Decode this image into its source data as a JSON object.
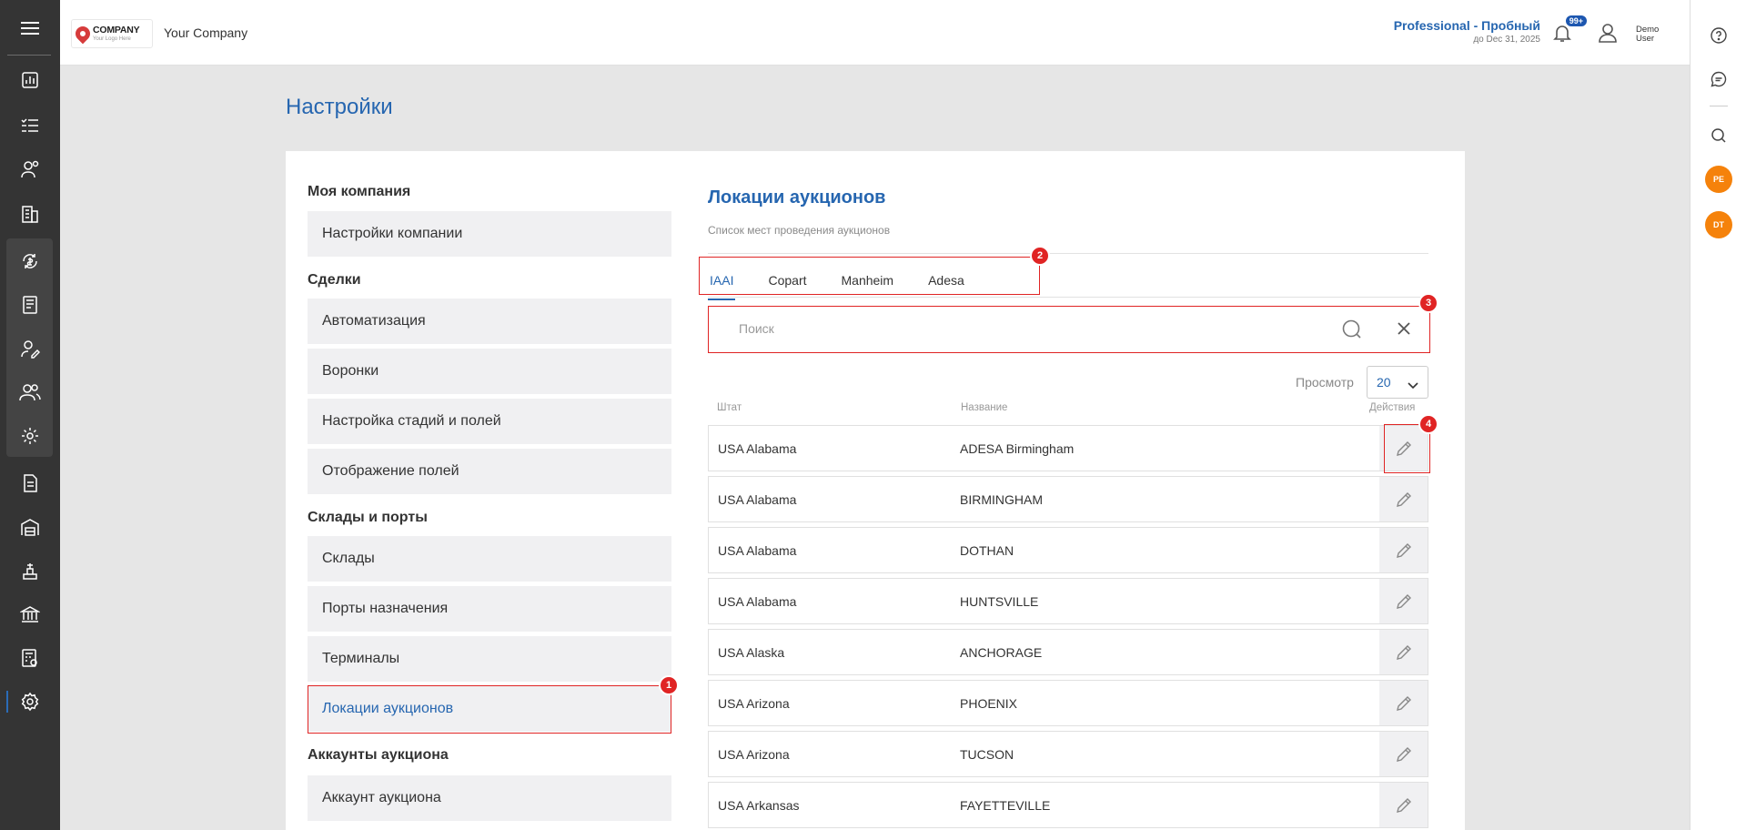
{
  "topbar": {
    "logo_name": "COMPANY",
    "logo_sub": "Your Logo Here",
    "company": "Your Company",
    "plan_name": "Professional - Пробный",
    "plan_date": "до Dec 31, 2025",
    "notif_count": "99+",
    "user_line1": "Demo",
    "user_line2": "User"
  },
  "rail": {
    "icons": [
      "menu-icon",
      "dashboard-icon",
      "tasks-icon",
      "contacts-icon",
      "companies-icon",
      "finance-icon",
      "invoices-icon",
      "user-edit-icon",
      "users-icon",
      "settings-gear-icon",
      "documents-icon",
      "warehouse-icon",
      "auction-icon",
      "bank-icon",
      "calculator-icon",
      "settings-icon"
    ]
  },
  "right_rail": {
    "avatar1": "PE",
    "avatar2": "DT"
  },
  "page": {
    "title": "Настройки"
  },
  "sidebar": {
    "sections": [
      {
        "title": "Моя компания",
        "items": [
          "Настройки компании"
        ]
      },
      {
        "title": "Сделки",
        "items": [
          "Автоматизация",
          "Воронки",
          "Настройка стадий и полей",
          "Отображение полей"
        ]
      },
      {
        "title": "Склады и порты",
        "items": [
          "Склады",
          "Порты назначения",
          "Терминалы",
          "Локации аукционов"
        ]
      },
      {
        "title": "Аккаунты аукциона",
        "items": [
          "Аккаунт аукциона"
        ]
      }
    ]
  },
  "content": {
    "title": "Локации аукционов",
    "subtitle": "Список мест проведения аукционов",
    "tabs": [
      "IAAI",
      "Copart",
      "Manheim",
      "Adesa"
    ],
    "search_placeholder": "Поиск",
    "view_label": "Просмотр",
    "view_value": "20",
    "columns": {
      "state": "Штат",
      "name": "Название",
      "actions": "Действия"
    },
    "rows": [
      {
        "state": "USA Alabama",
        "name": "ADESA Birmingham"
      },
      {
        "state": "USA Alabama",
        "name": "BIRMINGHAM"
      },
      {
        "state": "USA Alabama",
        "name": "DOTHAN"
      },
      {
        "state": "USA Alabama",
        "name": "HUNTSVILLE"
      },
      {
        "state": "USA Alaska",
        "name": "ANCHORAGE"
      },
      {
        "state": "USA Arizona",
        "name": "PHOENIX"
      },
      {
        "state": "USA Arizona",
        "name": "TUCSON"
      },
      {
        "state": "USA Arkansas",
        "name": "FAYETTEVILLE"
      }
    ]
  },
  "markers": [
    "1",
    "2",
    "3",
    "4"
  ],
  "colors": {
    "accent": "#2666b0",
    "highlight": "#e02424",
    "rail": "#343434",
    "avatar": "#f5820b"
  }
}
